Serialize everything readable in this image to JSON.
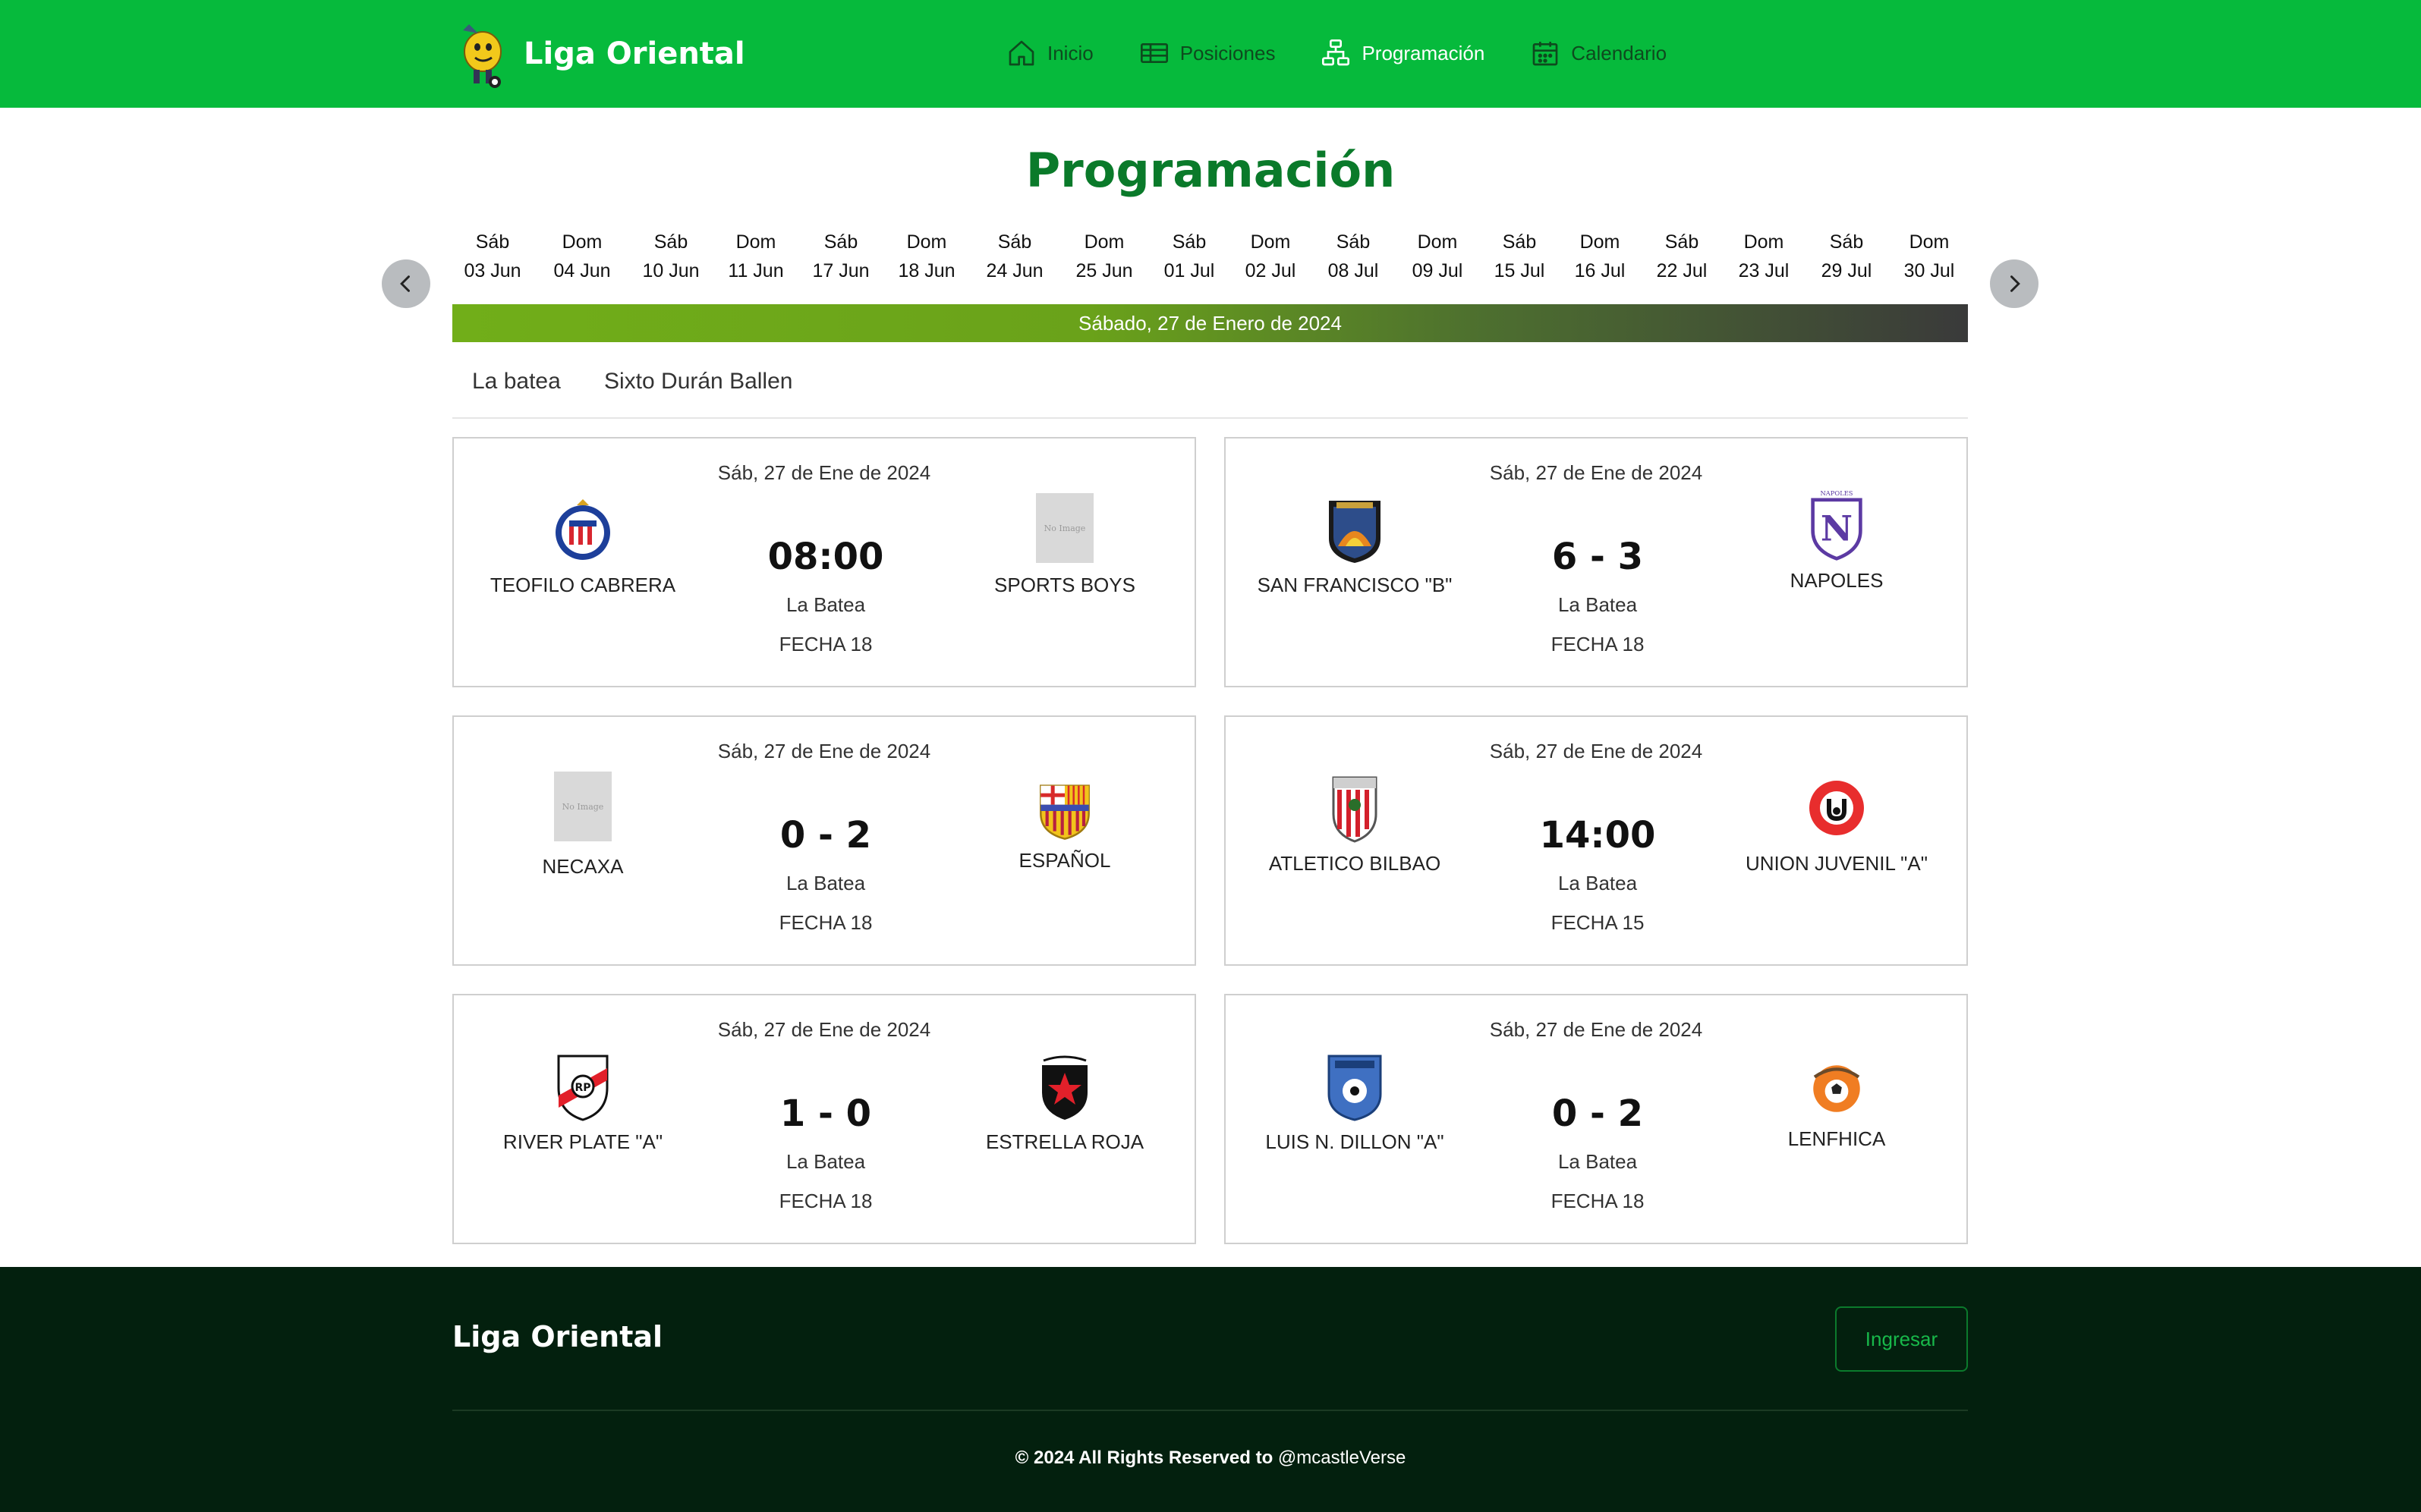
{
  "header": {
    "brand": "Liga Oriental",
    "nav": [
      {
        "label": "Inicio",
        "icon": "home-icon"
      },
      {
        "label": "Posiciones",
        "icon": "table-icon"
      },
      {
        "label": "Programación",
        "icon": "sitemap-icon",
        "active": true
      },
      {
        "label": "Calendario",
        "icon": "calendar-icon"
      }
    ]
  },
  "page_title": "Programación",
  "dates": [
    {
      "day": "Sáb",
      "date": "03 Jun"
    },
    {
      "day": "Dom",
      "date": "04 Jun"
    },
    {
      "day": "Sáb",
      "date": "10 Jun"
    },
    {
      "day": "Dom",
      "date": "11 Jun"
    },
    {
      "day": "Sáb",
      "date": "17 Jun"
    },
    {
      "day": "Dom",
      "date": "18 Jun"
    },
    {
      "day": "Sáb",
      "date": "24 Jun"
    },
    {
      "day": "Dom",
      "date": "25 Jun"
    },
    {
      "day": "Sáb",
      "date": "01 Jul"
    },
    {
      "day": "Dom",
      "date": "02 Jul"
    },
    {
      "day": "Sáb",
      "date": "08 Jul"
    },
    {
      "day": "Dom",
      "date": "09 Jul"
    },
    {
      "day": "Sáb",
      "date": "15 Jul"
    },
    {
      "day": "Dom",
      "date": "16 Jul"
    },
    {
      "day": "Sáb",
      "date": "22 Jul"
    },
    {
      "day": "Dom",
      "date": "23 Jul"
    },
    {
      "day": "Sáb",
      "date": "29 Jul"
    },
    {
      "day": "Dom",
      "date": "30 Jul"
    }
  ],
  "banner": "Sábado, 27 de Enero de 2024",
  "venues": [
    "La batea",
    "Sixto Durán Ballen"
  ],
  "matches": [
    {
      "date": "Sáb, 27 de Ene de 2024",
      "home": "TEOFILO CABRERA",
      "away": "SPORTS BOYS",
      "score": "08:00",
      "venue": "La Batea",
      "round": "FECHA 18",
      "home_crest": "chivas-crest",
      "away_crest": "no-image"
    },
    {
      "date": "Sáb, 27 de Ene de 2024",
      "home": "SAN FRANCISCO \"B\"",
      "away": "NAPOLES",
      "score": "6 - 3",
      "venue": "La Batea",
      "round": "FECHA 18",
      "home_crest": "san-francisco-crest",
      "away_crest": "napoles-crest"
    },
    {
      "date": "Sáb, 27 de Ene de 2024",
      "home": "NECAXA",
      "away": "ESPAÑOL",
      "score": "0 - 2",
      "venue": "La Batea",
      "round": "FECHA 18",
      "home_crest": "no-image",
      "away_crest": "espanol-crest"
    },
    {
      "date": "Sáb, 27 de Ene de 2024",
      "home": "ATLETICO BILBAO",
      "away": "UNION JUVENIL \"A\"",
      "score": "14:00",
      "venue": "La Batea",
      "round": "FECHA 15",
      "home_crest": "athletic-crest",
      "away_crest": "union-juvenil-crest"
    },
    {
      "date": "Sáb, 27 de Ene de 2024",
      "home": "RIVER PLATE \"A\"",
      "away": "ESTRELLA ROJA",
      "score": "1 - 0",
      "venue": "La Batea",
      "round": "FECHA 18",
      "home_crest": "river-plate-crest",
      "away_crest": "estrella-roja-crest"
    },
    {
      "date": "Sáb, 27 de Ene de 2024",
      "home": "LUIS N. DILLON \"A\"",
      "away": "LENFHICA",
      "score": "0 - 2",
      "venue": "La Batea",
      "round": "FECHA 18",
      "home_crest": "luis-dillon-crest",
      "away_crest": "lenfhica-crest"
    }
  ],
  "no_image_text": "No Image",
  "footer": {
    "brand": "Liga Oriental",
    "login": "Ingresar",
    "copyright": "© 2024 All Rights Reserved to",
    "handle": "@mcastleVerse"
  },
  "colors": {
    "header_bg": "#06ba3c",
    "title": "#0a7a2a",
    "footer_bg": "#03200e",
    "login_text": "#18b84a"
  }
}
